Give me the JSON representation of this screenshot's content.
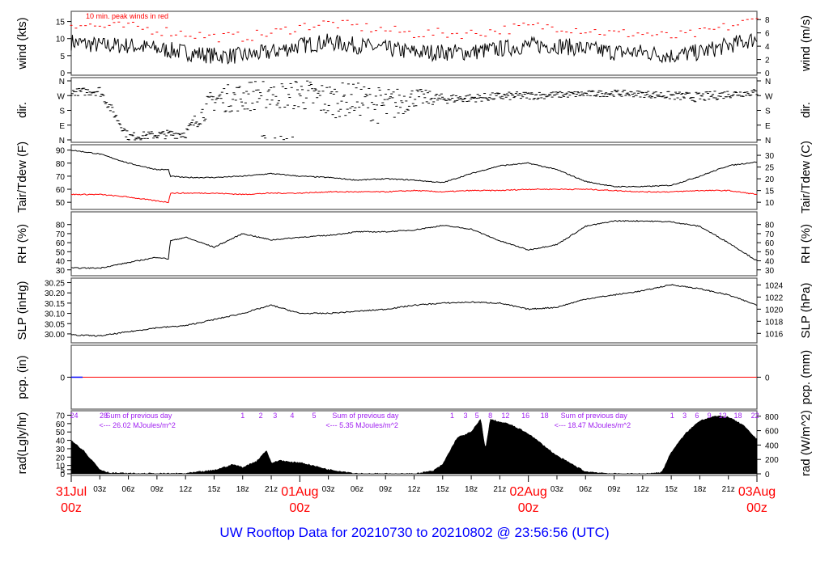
{
  "title": "UW Rooftop Data for 20210730  to  20210802 @ 23:56:56  (UTC)",
  "colors": {
    "title": "#0000ff",
    "day": "#ff0000",
    "peak": "#ff0000",
    "dew": "#ff0000",
    "rad_text": "#a020f0",
    "pcp": "#0000ff"
  },
  "chart_data": [
    {
      "type": "line",
      "id": "wind",
      "ylabel": "wind (kts)",
      "ylabel_right": "wind (m/s)",
      "ylim": [
        0,
        17.5
      ],
      "yticks": [
        0,
        5,
        10,
        15
      ],
      "yticks_right": [
        0,
        2,
        4,
        6,
        8
      ],
      "right_factor": 1.944,
      "annotation": "10 min. peak winds in red",
      "x": [
        0,
        3,
        6,
        9,
        12,
        15,
        18,
        21,
        24,
        27,
        30,
        33,
        36,
        39,
        42,
        45,
        48,
        51,
        54,
        57,
        60,
        63,
        66,
        69,
        72
      ],
      "values": [
        9,
        8,
        8,
        7,
        6,
        5,
        5,
        6,
        8,
        9,
        8,
        7,
        6,
        6,
        6,
        7,
        8,
        8,
        7,
        6,
        6,
        5,
        6,
        8,
        10
      ],
      "peak_offset": 4
    },
    {
      "type": "scatter",
      "id": "dir",
      "ylabel": "dir.",
      "ylabel_right": "dir.",
      "ylim": [
        0,
        360
      ],
      "yticks": [
        0,
        90,
        180,
        270,
        360
      ],
      "ytick_labels": [
        "N",
        "E",
        "S",
        "W",
        "N"
      ],
      "x": [
        0,
        3,
        6,
        9,
        12,
        15,
        18,
        21,
        24,
        27,
        30,
        33,
        36,
        39,
        42,
        45,
        48,
        51,
        54,
        57,
        60,
        63,
        66,
        69,
        72
      ],
      "values": [
        290,
        300,
        20,
        30,
        40,
        250,
        260,
        300,
        280,
        240,
        250,
        200,
        260,
        250,
        255,
        265,
        270,
        275,
        280,
        285,
        280,
        270,
        260,
        280,
        290
      ],
      "spread": [
        20,
        30,
        25,
        25,
        30,
        80,
        90,
        110,
        100,
        110,
        100,
        120,
        60,
        30,
        25,
        25,
        25,
        20,
        20,
        20,
        20,
        25,
        30,
        25,
        20
      ]
    },
    {
      "type": "line",
      "id": "temp",
      "ylabel": "Tair/Tdew (F)",
      "ylabel_right": "Tair/Tdew (C)",
      "ylim": [
        47,
        91
      ],
      "yticks": [
        50,
        60,
        70,
        80,
        90
      ],
      "yticks_right": [
        10,
        15,
        20,
        25,
        30
      ],
      "x": [
        0,
        3,
        6,
        9,
        10.2,
        10.4,
        12,
        15,
        18,
        21,
        24,
        27,
        30,
        33,
        36,
        39,
        42,
        45,
        48,
        51,
        54,
        57,
        60,
        63,
        66,
        69,
        72
      ],
      "series": [
        {
          "name": "Tair",
          "values": [
            90,
            87,
            80,
            75,
            75,
            70,
            69,
            69,
            70,
            72,
            70,
            69,
            67,
            68,
            67,
            65,
            72,
            78,
            80,
            75,
            66,
            62,
            62,
            63,
            70,
            78,
            81
          ]
        },
        {
          "name": "Tdew",
          "values": [
            56,
            56,
            54,
            51,
            50,
            57,
            57,
            57,
            56,
            57,
            57,
            58,
            58,
            58,
            59,
            58,
            59,
            59,
            60,
            60,
            60,
            59,
            58,
            58,
            59,
            59,
            56
          ]
        }
      ]
    },
    {
      "type": "line",
      "id": "rh",
      "ylabel": "RH (%)",
      "ylabel_right": "RH (%)",
      "ylim": [
        28,
        86
      ],
      "yticks": [
        30,
        40,
        50,
        60,
        70,
        80
      ],
      "yticks_right": [
        30,
        40,
        50,
        60,
        70,
        80
      ],
      "x": [
        0,
        3,
        6,
        9,
        10.2,
        10.4,
        12,
        15,
        18,
        21,
        24,
        27,
        30,
        33,
        36,
        39,
        42,
        45,
        48,
        51,
        54,
        57,
        60,
        63,
        66,
        69,
        72
      ],
      "values": [
        32,
        32,
        38,
        44,
        42,
        62,
        66,
        55,
        70,
        63,
        66,
        68,
        72,
        72,
        74,
        79,
        75,
        62,
        52,
        58,
        78,
        84,
        84,
        83,
        78,
        60,
        40
      ]
    },
    {
      "type": "line",
      "id": "slp",
      "ylabel": "SLP (inHg)",
      "ylabel_right": "SLP (hPa)",
      "ylim": [
        29.98,
        30.26
      ],
      "yticks": [
        30.0,
        30.05,
        30.1,
        30.15,
        30.2,
        30.25
      ],
      "yticks_right": [
        1016,
        1018,
        1020,
        1022,
        1024
      ],
      "x": [
        0,
        3,
        6,
        9,
        12,
        15,
        18,
        21,
        24,
        27,
        30,
        33,
        36,
        39,
        42,
        45,
        48,
        51,
        54,
        57,
        60,
        63,
        66,
        69,
        72
      ],
      "values": [
        29.995,
        29.99,
        30.01,
        30.03,
        30.04,
        30.07,
        30.1,
        30.14,
        30.1,
        30.1,
        30.11,
        30.12,
        30.14,
        30.15,
        30.155,
        30.15,
        30.12,
        30.13,
        30.17,
        30.19,
        30.21,
        30.24,
        30.22,
        30.19,
        30.14
      ]
    },
    {
      "type": "line",
      "id": "pcp",
      "ylabel": "pcp. (in)",
      "ylabel_right": "pcp. (mm)",
      "ylim": [
        -1,
        1
      ],
      "yticks": [
        0
      ],
      "yticks_right": [
        0
      ],
      "x": [
        0,
        72
      ],
      "values": [
        0,
        0
      ]
    },
    {
      "type": "area",
      "id": "rad",
      "ylabel": "rad(Lgly/hr)",
      "ylabel_right": "rad (W/m^2)",
      "ylim": [
        0,
        820
      ],
      "yticks_left": [
        0,
        5,
        10,
        20,
        30,
        40,
        50,
        60,
        70
      ],
      "left_factor": 11.63,
      "yticks_right": [
        0,
        200,
        400,
        600,
        800
      ],
      "x": [
        0,
        1.5,
        2,
        2.2,
        3,
        4,
        6,
        9,
        12,
        15,
        17,
        18,
        19.5,
        20.5,
        21,
        22,
        23,
        24,
        27,
        30,
        33,
        36,
        38,
        39,
        40.5,
        42,
        43,
        43.5,
        44,
        45,
        46,
        48,
        51,
        54,
        57,
        60,
        62,
        63,
        64.5,
        66,
        67.5,
        69,
        70.5,
        72
      ],
      "values": [
        470,
        300,
        200,
        190,
        60,
        15,
        5,
        3,
        5,
        50,
        130,
        90,
        180,
        330,
        150,
        190,
        160,
        160,
        60,
        5,
        0,
        0,
        40,
        130,
        500,
        580,
        760,
        330,
        760,
        720,
        690,
        560,
        250,
        30,
        0,
        0,
        20,
        300,
        560,
        740,
        800,
        790,
        680,
        480
      ],
      "hour_labels": [
        {
          "text": "24",
          "x": 0.3
        },
        {
          "text": "28",
          "x": 3.4
        },
        {
          "text": "1",
          "x": 18
        },
        {
          "text": "2",
          "x": 19.9
        },
        {
          "text": "3",
          "x": 21.4
        },
        {
          "text": "4",
          "x": 23.2
        },
        {
          "text": "5",
          "x": 25.5
        },
        {
          "text": "1",
          "x": 40
        },
        {
          "text": "3",
          "x": 41.4
        },
        {
          "text": "5",
          "x": 42.6
        },
        {
          "text": "8",
          "x": 44
        },
        {
          "text": "12",
          "x": 45.6
        },
        {
          "text": "16",
          "x": 47.7
        },
        {
          "text": "18",
          "x": 49.7
        },
        {
          "text": "1",
          "x": 63.1
        },
        {
          "text": "3",
          "x": 64.4
        },
        {
          "text": "6",
          "x": 65.7
        },
        {
          "text": "9",
          "x": 67
        },
        {
          "text": "13",
          "x": 68.4
        },
        {
          "text": "18",
          "x": 70
        },
        {
          "text": "22",
          "x": 71.8
        }
      ],
      "sums": [
        {
          "label": "Sum of previous day",
          "value": "<--- 26.02 MJoules/m^2",
          "x": 3.6
        },
        {
          "label": "Sum of previous day",
          "value": "<--- 5.35 MJoules/m^2",
          "x": 27.4
        },
        {
          "label": "Sum of previous day",
          "value": "<--- 18.47 MJoules/m^2",
          "x": 51.4
        }
      ]
    }
  ],
  "xaxis": {
    "hour_ticks": [
      {
        "x": 3,
        "t": "03z"
      },
      {
        "x": 6,
        "t": "06z"
      },
      {
        "x": 9,
        "t": "09z"
      },
      {
        "x": 12,
        "t": "12z"
      },
      {
        "x": 15,
        "t": "15z"
      },
      {
        "x": 18,
        "t": "18z"
      },
      {
        "x": 21,
        "t": "21z"
      },
      {
        "x": 27,
        "t": "03z"
      },
      {
        "x": 30,
        "t": "06z"
      },
      {
        "x": 33,
        "t": "09z"
      },
      {
        "x": 36,
        "t": "12z"
      },
      {
        "x": 39,
        "t": "15z"
      },
      {
        "x": 42,
        "t": "18z"
      },
      {
        "x": 45,
        "t": "21z"
      },
      {
        "x": 51,
        "t": "03z"
      },
      {
        "x": 54,
        "t": "06z"
      },
      {
        "x": 57,
        "t": "09z"
      },
      {
        "x": 60,
        "t": "12z"
      },
      {
        "x": 63,
        "t": "15z"
      },
      {
        "x": 66,
        "t": "18z"
      },
      {
        "x": 69,
        "t": "21z"
      }
    ],
    "days": [
      {
        "x": 0,
        "date": "31Jul",
        "z": "00z"
      },
      {
        "x": 24,
        "date": "01Aug",
        "z": "00z"
      },
      {
        "x": 48,
        "date": "02Aug",
        "z": "00z"
      },
      {
        "x": 72,
        "date": "03Aug",
        "z": "00z"
      }
    ]
  }
}
